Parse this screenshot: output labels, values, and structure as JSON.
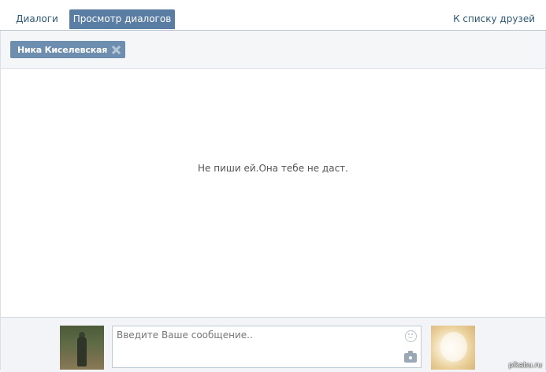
{
  "tabs": {
    "dialogs": "Диалоги",
    "view_dialogs": "Просмотр диалогов",
    "friends_list": "К списку друзей"
  },
  "peer": {
    "name": "Ника Киселевская"
  },
  "history": {
    "message": "Не пиши ей.Она тебе не даст."
  },
  "composer": {
    "placeholder": "Введите Ваше сообщение.."
  },
  "watermark": "pikabu.ru",
  "colors": {
    "accent": "#597da3",
    "chip": "#6e8eb0",
    "link": "#2b587a"
  }
}
